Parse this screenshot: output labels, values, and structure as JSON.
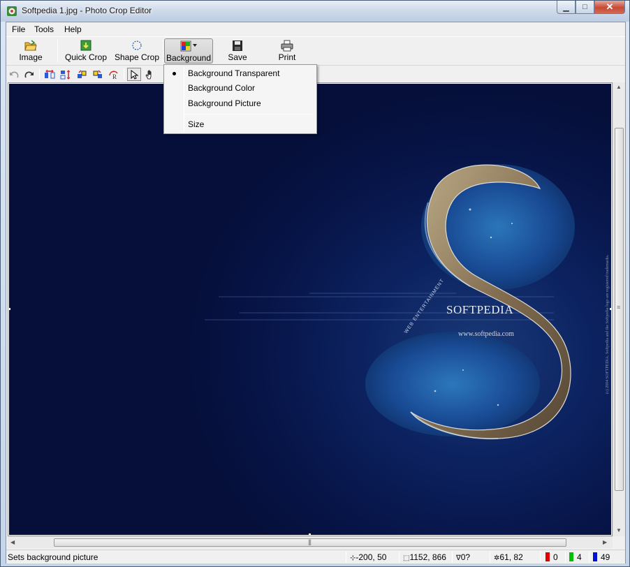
{
  "window": {
    "title": "Softpedia 1.jpg - Photo Crop Editor",
    "minimize": "▁",
    "maximize": "□",
    "close": "✕"
  },
  "menu": {
    "file": "File",
    "tools": "Tools",
    "help": "Help"
  },
  "toolbar": {
    "image": "Image",
    "quick_crop": "Quick Crop",
    "shape_crop": "Shape Crop",
    "background": "Background",
    "save": "Save",
    "print": "Print"
  },
  "dropdown": {
    "items": [
      {
        "label": "Background Transparent",
        "checked": true
      },
      {
        "label": "Background Color"
      },
      {
        "label": "Background Picture"
      },
      {
        "label": "Size"
      }
    ]
  },
  "image_text": {
    "brand": "SOFTPEDIA",
    "url": "www.softpedia.com",
    "tagline": "WEB ENTERTAINMENT",
    "legal": "(c) 2004 SOFTPEDIA. Softpedia and the Softpedia logo are registered trademarks."
  },
  "status": {
    "message": "Sets background picture",
    "offset": "-200, 50",
    "size": "1152, 866",
    "angle": "0?",
    "cursor": "61, 82",
    "red": "0",
    "green": "4",
    "blue": "49"
  },
  "colors": {
    "red": "#e00000",
    "green": "#00c000",
    "blue": "#0010d0"
  }
}
